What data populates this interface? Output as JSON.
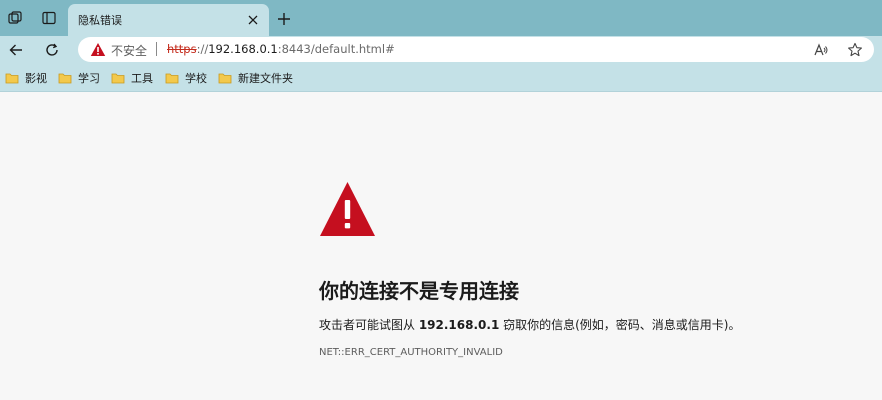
{
  "tab": {
    "title": "隐私错误"
  },
  "toolbar": {
    "security_label": "不安全",
    "url_scheme": "https",
    "url_rest_prefix": "://",
    "url_host": "192.168.0.1",
    "url_rest": ":8443/default.html#"
  },
  "bookmarks": [
    {
      "label": "影视"
    },
    {
      "label": "学习"
    },
    {
      "label": "工具"
    },
    {
      "label": "学校"
    },
    {
      "label": "新建文件夹"
    }
  ],
  "error": {
    "title": "你的连接不是专用连接",
    "desc_prefix": "攻击者可能试图从 ",
    "desc_host": "192.168.0.1",
    "desc_suffix": " 窃取你的信息(例如，密码、消息或信用卡)。",
    "code": "NET::ERR_CERT_AUTHORITY_INVALID"
  },
  "colors": {
    "tabstrip": "#7fb8c4",
    "toolbar": "#c4e1e7",
    "warning_red": "#c50f1f",
    "folder_yellow": "#f3c94c"
  },
  "icons": {
    "workspaces": "workspaces-icon",
    "tab_actions": "tab-actions-icon",
    "close": "close-icon",
    "new_tab": "plus-icon",
    "back": "back-arrow-icon",
    "refresh": "refresh-icon",
    "warning": "warning-triangle-icon",
    "read_aloud": "read-aloud-icon",
    "favorite": "star-icon",
    "folder": "folder-icon"
  }
}
